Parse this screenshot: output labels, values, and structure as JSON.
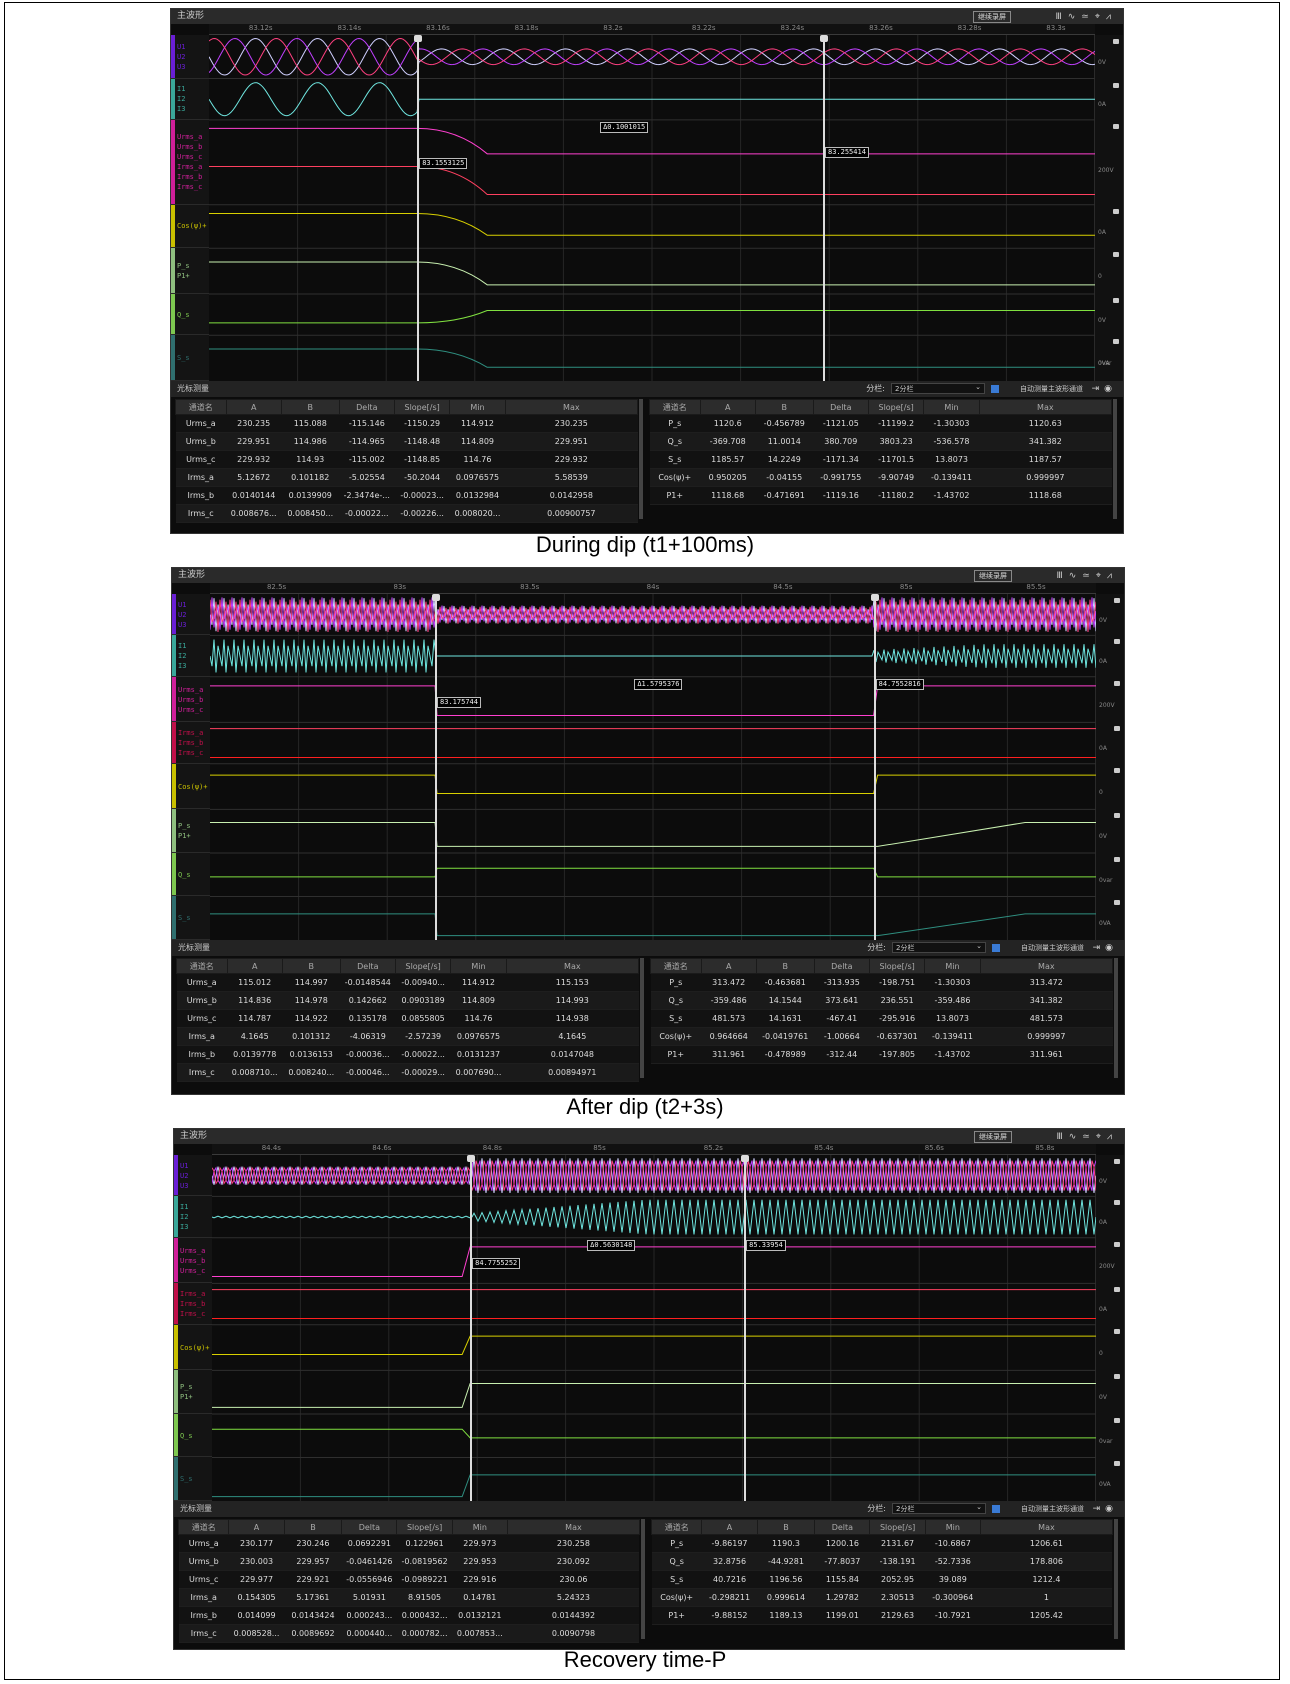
{
  "panels": [
    {
      "caption": "During dip (t1+100ms)",
      "window_title": "主波形",
      "continue_btn": "继续录屏",
      "toolbar_icons": [
        "waveform-icon",
        "sine-icon",
        "filter-icon",
        "crosshair-icon",
        "chart-icon"
      ],
      "ruler": [
        "83.12s",
        "83.14s",
        "83.16s",
        "83.18s",
        "83.2s",
        "83.22s",
        "83.24s",
        "83.26s",
        "83.28s",
        "83.3s"
      ],
      "channels": [
        {
          "labels": "U1\nU2\nU3",
          "color": "#6a1fd6"
        },
        {
          "labels": "I1\nI2\nI3",
          "color": "#3aa89a"
        },
        {
          "labels": "Urms_a\nUrms_b\nUrms_c\nIrms_a\nIrms_b\nIrms_c",
          "color": "#d01f9a"
        },
        {
          "labels": "Cos(ψ)+",
          "color": "#c9c000"
        },
        {
          "labels": "P_s\nP1+",
          "color": "#8fbf7f"
        },
        {
          "labels": "Q_s",
          "color": "#7ec850"
        },
        {
          "labels": "S_s",
          "color": "#2f6f6f"
        }
      ],
      "units": [
        "0V",
        "0A",
        "200V",
        "0A",
        "0",
        "0V",
        "0var",
        "0VA"
      ],
      "cursor_delta": "Δ0.1001015",
      "cursor_a": "83.1553125",
      "cursor_b": "83.255414",
      "meas_title": "光标测量",
      "split_label": "分栏:",
      "split_value": "2分栏",
      "auto_label": "自动测量主波形通道",
      "left_header": [
        "通道名",
        "A",
        "B",
        "Delta",
        "Slope[/s]",
        "Min",
        "Max"
      ],
      "left_rows": [
        [
          "Urms_a",
          "230.235",
          "115.088",
          "-115.146",
          "-1150.29",
          "114.912",
          "230.235"
        ],
        [
          "Urms_b",
          "229.951",
          "114.986",
          "-114.965",
          "-1148.48",
          "114.809",
          "229.951"
        ],
        [
          "Urms_c",
          "229.932",
          "114.93",
          "-115.002",
          "-1148.85",
          "114.76",
          "229.932"
        ],
        [
          "Irms_a",
          "5.12672",
          "0.101182",
          "-5.02554",
          "-50.2044",
          "0.0976575",
          "5.58539"
        ],
        [
          "Irms_b",
          "0.0140144",
          "0.0139909",
          "-2.3474e-...",
          "-0.00023...",
          "0.0132984",
          "0.0142958"
        ],
        [
          "Irms_c",
          "0.008676...",
          "0.008450...",
          "-0.00022...",
          "-0.00226...",
          "0.008020...",
          "0.00900757"
        ]
      ],
      "right_header": [
        "通道名",
        "A",
        "B",
        "Delta",
        "Slope[/s]",
        "Min",
        "Max"
      ],
      "right_rows": [
        [
          "P_s",
          "1120.6",
          "-0.456789",
          "-1121.05",
          "-11199.2",
          "-1.30303",
          "1120.63"
        ],
        [
          "Q_s",
          "-369.708",
          "11.0014",
          "380.709",
          "3803.23",
          "-536.578",
          "341.382"
        ],
        [
          "S_s",
          "1185.57",
          "14.2249",
          "-1171.34",
          "-11701.5",
          "13.8073",
          "1187.57"
        ],
        [
          "Cos(ψ)+",
          "0.950205",
          "-0.04155",
          "-0.991755",
          "-9.90749",
          "-0.139411",
          "0.999997"
        ],
        [
          "P1+",
          "1118.68",
          "-0.471691",
          "-1119.16",
          "-11180.2",
          "-1.43702",
          "1118.68"
        ]
      ]
    },
    {
      "caption": "After dip (t2+3s)",
      "window_title": "主波形",
      "continue_btn": "继续录屏",
      "toolbar_icons": [
        "waveform-icon",
        "sine-icon",
        "filter-icon",
        "crosshair-icon",
        "chart-icon"
      ],
      "ruler": [
        "82.5s",
        "83s",
        "83.5s",
        "84s",
        "84.5s",
        "85s",
        "85.5s"
      ],
      "channels": [
        {
          "labels": "U1\nU2\nU3",
          "color": "#6a1fd6"
        },
        {
          "labels": "I1\nI2\nI3",
          "color": "#3aa89a"
        },
        {
          "labels": "Urms_a\nUrms_b\nUrms_c",
          "color": "#d01f9a"
        },
        {
          "labels": "Irms_a\nIrms_b\nIrms_c",
          "color": "#c0104a"
        },
        {
          "labels": "Cos(ψ)+",
          "color": "#c9c000"
        },
        {
          "labels": "P_s\nP1+",
          "color": "#8fbf7f"
        },
        {
          "labels": "Q_s",
          "color": "#7ec850"
        },
        {
          "labels": "S_s",
          "color": "#2f6f6f"
        }
      ],
      "units": [
        "0V",
        "0A",
        "200V",
        "0A",
        "0",
        "0V",
        "0var",
        "0VA"
      ],
      "cursor_delta": "Δ1.5795376",
      "cursor_a": "83.175744",
      "cursor_b": "84.7552816",
      "meas_title": "光标测量",
      "split_label": "分栏:",
      "split_value": "2分栏",
      "auto_label": "自动测量主波形通道",
      "left_header": [
        "通道名",
        "A",
        "B",
        "Delta",
        "Slope[/s]",
        "Min",
        "Max"
      ],
      "left_rows": [
        [
          "Urms_a",
          "115.012",
          "114.997",
          "-0.0148544",
          "-0.00940...",
          "114.912",
          "115.153"
        ],
        [
          "Urms_b",
          "114.836",
          "114.978",
          "0.142662",
          "0.0903189",
          "114.809",
          "114.993"
        ],
        [
          "Urms_c",
          "114.787",
          "114.922",
          "0.135178",
          "0.0855805",
          "114.76",
          "114.938"
        ],
        [
          "Irms_a",
          "4.1645",
          "0.101312",
          "-4.06319",
          "-2.57239",
          "0.0976575",
          "4.1645"
        ],
        [
          "Irms_b",
          "0.0139778",
          "0.0136153",
          "-0.00036...",
          "-0.00022...",
          "0.0131237",
          "0.0147048"
        ],
        [
          "Irms_c",
          "0.008710...",
          "0.008240...",
          "-0.00046...",
          "-0.00029...",
          "0.007690...",
          "0.00894971"
        ]
      ],
      "right_header": [
        "通道名",
        "A",
        "B",
        "Delta",
        "Slope[/s]",
        "Min",
        "Max"
      ],
      "right_rows": [
        [
          "P_s",
          "313.472",
          "-0.463681",
          "-313.935",
          "-198.751",
          "-1.30303",
          "313.472"
        ],
        [
          "Q_s",
          "-359.486",
          "14.1544",
          "373.641",
          "236.551",
          "-359.486",
          "341.382"
        ],
        [
          "S_s",
          "481.573",
          "14.1631",
          "-467.41",
          "-295.916",
          "13.8073",
          "481.573"
        ],
        [
          "Cos(ψ)+",
          "0.964664",
          "-0.0419761",
          "-1.00664",
          "-0.637301",
          "-0.139411",
          "0.999997"
        ],
        [
          "P1+",
          "311.961",
          "-0.478989",
          "-312.44",
          "-197.805",
          "-1.43702",
          "311.961"
        ]
      ]
    },
    {
      "caption": "Recovery time-P",
      "window_title": "主波形",
      "continue_btn": "继续录屏",
      "toolbar_icons": [
        "waveform-icon",
        "sine-icon",
        "filter-icon",
        "crosshair-icon",
        "chart-icon"
      ],
      "ruler": [
        "84.4s",
        "84.6s",
        "84.8s",
        "85s",
        "85.2s",
        "85.4s",
        "85.6s",
        "85.8s"
      ],
      "channels": [
        {
          "labels": "U1\nU2\nU3",
          "color": "#6a1fd6"
        },
        {
          "labels": "I1\nI2\nI3",
          "color": "#3aa89a"
        },
        {
          "labels": "Urms_a\nUrms_b\nUrms_c",
          "color": "#d01f9a"
        },
        {
          "labels": "Irms_a\nIrms_b\nIrms_c",
          "color": "#c0104a"
        },
        {
          "labels": "Cos(ψ)+",
          "color": "#c9c000"
        },
        {
          "labels": "P_s\nP1+",
          "color": "#8fbf7f"
        },
        {
          "labels": "Q_s",
          "color": "#7ec850"
        },
        {
          "labels": "S_s",
          "color": "#2f6f6f"
        }
      ],
      "units": [
        "0V",
        "0A",
        "200V",
        "0A",
        "0",
        "0V",
        "0var",
        "0VA"
      ],
      "cursor_delta": "Δ0.5630148",
      "cursor_a": "84.7755252",
      "cursor_b": "85.33954",
      "meas_title": "光标测量",
      "split_label": "分栏:",
      "split_value": "2分栏",
      "auto_label": "自动测量主波形通道",
      "left_header": [
        "通道名",
        "A",
        "B",
        "Delta",
        "Slope[/s]",
        "Min",
        "Max"
      ],
      "left_rows": [
        [
          "Urms_a",
          "230.177",
          "230.246",
          "0.0692291",
          "0.122961",
          "229.973",
          "230.258"
        ],
        [
          "Urms_b",
          "230.003",
          "229.957",
          "-0.0461426",
          "-0.0819562",
          "229.953",
          "230.092"
        ],
        [
          "Urms_c",
          "229.977",
          "229.921",
          "-0.0556946",
          "-0.0989221",
          "229.916",
          "230.06"
        ],
        [
          "Irms_a",
          "0.154305",
          "5.17361",
          "5.01931",
          "8.91505",
          "0.14781",
          "5.24323"
        ],
        [
          "Irms_b",
          "0.014099",
          "0.0143424",
          "0.000243...",
          "0.000432...",
          "0.0132121",
          "0.0144392"
        ],
        [
          "Irms_c",
          "0.008528...",
          "0.0089692",
          "0.000440...",
          "0.000782...",
          "0.007853...",
          "0.0090798"
        ]
      ],
      "right_header": [
        "通道名",
        "A",
        "B",
        "Delta",
        "Slope[/s]",
        "Min",
        "Max"
      ],
      "right_rows": [
        [
          "P_s",
          "-9.86197",
          "1190.3",
          "1200.16",
          "2131.67",
          "-10.6867",
          "1206.61"
        ],
        [
          "Q_s",
          "32.8756",
          "-44.9281",
          "-77.8037",
          "-138.191",
          "-52.7336",
          "178.806"
        ],
        [
          "S_s",
          "40.7216",
          "1196.56",
          "1155.84",
          "2052.95",
          "39.089",
          "1212.4"
        ],
        [
          "Cos(ψ)+",
          "-0.298211",
          "0.999614",
          "1.29782",
          "2.30513",
          "-0.300964",
          "1"
        ],
        [
          "P1+",
          "-9.88152",
          "1189.13",
          "1199.01",
          "2129.63",
          "-10.7921",
          "1205.42"
        ]
      ]
    }
  ]
}
